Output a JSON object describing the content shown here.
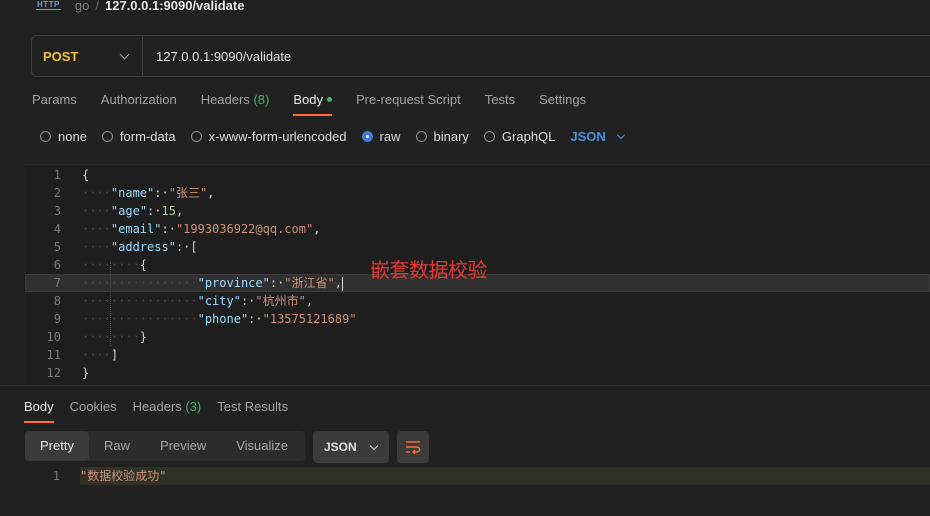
{
  "breadcrumb": {
    "method_icon": "HTTP",
    "collection": "go",
    "separator": "/",
    "title": "127.0.0.1:9090/validate"
  },
  "request": {
    "method": "POST",
    "url": "127.0.0.1:9090/validate"
  },
  "tabs": [
    {
      "label": "Params"
    },
    {
      "label": "Authorization"
    },
    {
      "label": "Headers",
      "count": "(8)"
    },
    {
      "label": "Body",
      "active": true
    },
    {
      "label": "Pre-request Script"
    },
    {
      "label": "Tests"
    },
    {
      "label": "Settings"
    }
  ],
  "body_types": {
    "none": "none",
    "form_data": "form-data",
    "urlencoded": "x-www-form-urlencoded",
    "raw": "raw",
    "binary": "binary",
    "graphql": "GraphQL",
    "format": "JSON",
    "selected": "raw"
  },
  "editor": {
    "line_numbers": [
      "1",
      "2",
      "3",
      "4",
      "5",
      "6",
      "7",
      "8",
      "9",
      "10",
      "11",
      "12"
    ],
    "annotation": "嵌套数据校验",
    "lines": {
      "l1": "{",
      "name_key": "\"name\"",
      "name_val": "\"张三\"",
      "age_key": "\"age\"",
      "age_val": "15",
      "email_key": "\"email\"",
      "email_val": "\"1993036922@qq.com\"",
      "address_key": "\"address\"",
      "address_open": "[",
      "obj_open": "{",
      "province_key": "\"province\"",
      "province_val": "\"浙江省\"",
      "city_key": "\"city\"",
      "city_val": "\"杭州市\"",
      "phone_key": "\"phone\"",
      "phone_val": "\"13575121689\"",
      "obj_close": "}",
      "address_close": "]",
      "l12": "}"
    }
  },
  "response": {
    "tabs": [
      {
        "label": "Body",
        "active": true
      },
      {
        "label": "Cookies"
      },
      {
        "label": "Headers",
        "count": "(3)"
      },
      {
        "label": "Test Results"
      }
    ],
    "views": [
      "Pretty",
      "Raw",
      "Preview",
      "Visualize"
    ],
    "active_view": "Pretty",
    "format": "JSON",
    "line_number": "1",
    "body": "\"数据校验成功\""
  },
  "colors": {
    "accent": "#ff6c37",
    "method": "#f0c13c",
    "count": "#41b36e",
    "link": "#4d8fdc",
    "annotation": "#e53935"
  },
  "icons": {
    "http": "http-icon",
    "chevron": "chevron-down-icon",
    "wrap": "wrap-lines-icon"
  }
}
